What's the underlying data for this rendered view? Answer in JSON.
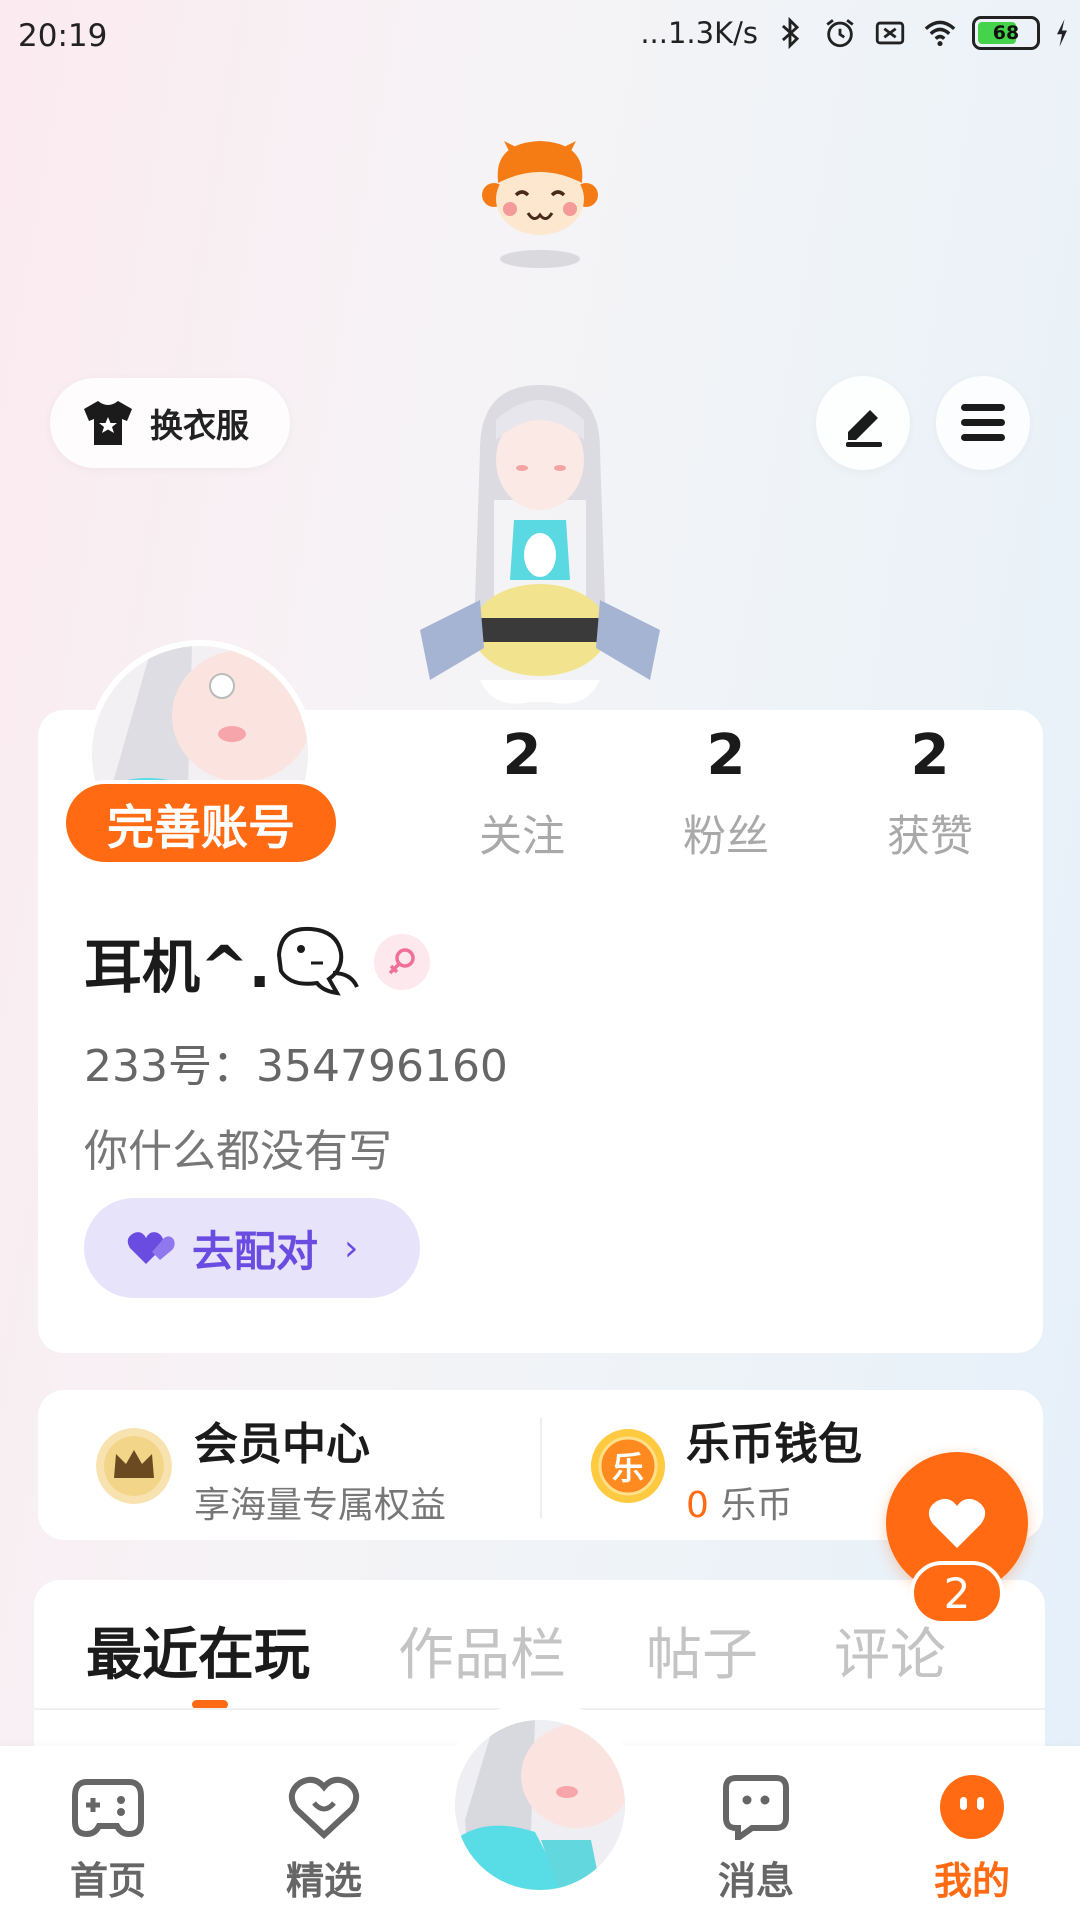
{
  "status_bar": {
    "time": "20:19",
    "network_speed": "...1.3K/s",
    "battery_level": "68"
  },
  "header": {
    "outfit_button_label": "换衣服",
    "edit_icon": "pencil-icon",
    "menu_icon": "hamburger-menu-icon"
  },
  "profile": {
    "complete_account_label": "完善账号",
    "stats": [
      {
        "count": "2",
        "label": "关注"
      },
      {
        "count": "2",
        "label": "粉丝"
      },
      {
        "count": "2",
        "label": "获赞"
      }
    ],
    "username": "耳机^.",
    "gender": "female",
    "user_id": "233号：354796160",
    "bio": "你什么都没有写",
    "match_button_label": "去配对"
  },
  "wallet": {
    "membership": {
      "title": "会员中心",
      "subtitle": "享海量专属权益"
    },
    "coins": {
      "title": "乐币钱包",
      "amount": "0",
      "unit": "乐币",
      "icon_text": "乐"
    }
  },
  "floating_button": {
    "icon": "heart-icon",
    "count": "2"
  },
  "tabs": [
    {
      "label": "最近在玩",
      "active": true
    },
    {
      "label": "作品栏",
      "active": false
    },
    {
      "label": "帖子",
      "active": false
    },
    {
      "label": "评论",
      "active": false
    }
  ],
  "bottom_nav": [
    {
      "label": "首页",
      "icon": "gamepad-icon",
      "active": false
    },
    {
      "label": "精选",
      "icon": "heart-chat-icon",
      "active": false
    },
    {
      "label": "消息",
      "icon": "message-icon",
      "active": false
    },
    {
      "label": "我的",
      "icon": "profile-face-icon",
      "active": true
    }
  ],
  "colors": {
    "accent": "#ff6a12",
    "match_bg": "#e6e3fb",
    "match_text": "#6a4ce0"
  }
}
